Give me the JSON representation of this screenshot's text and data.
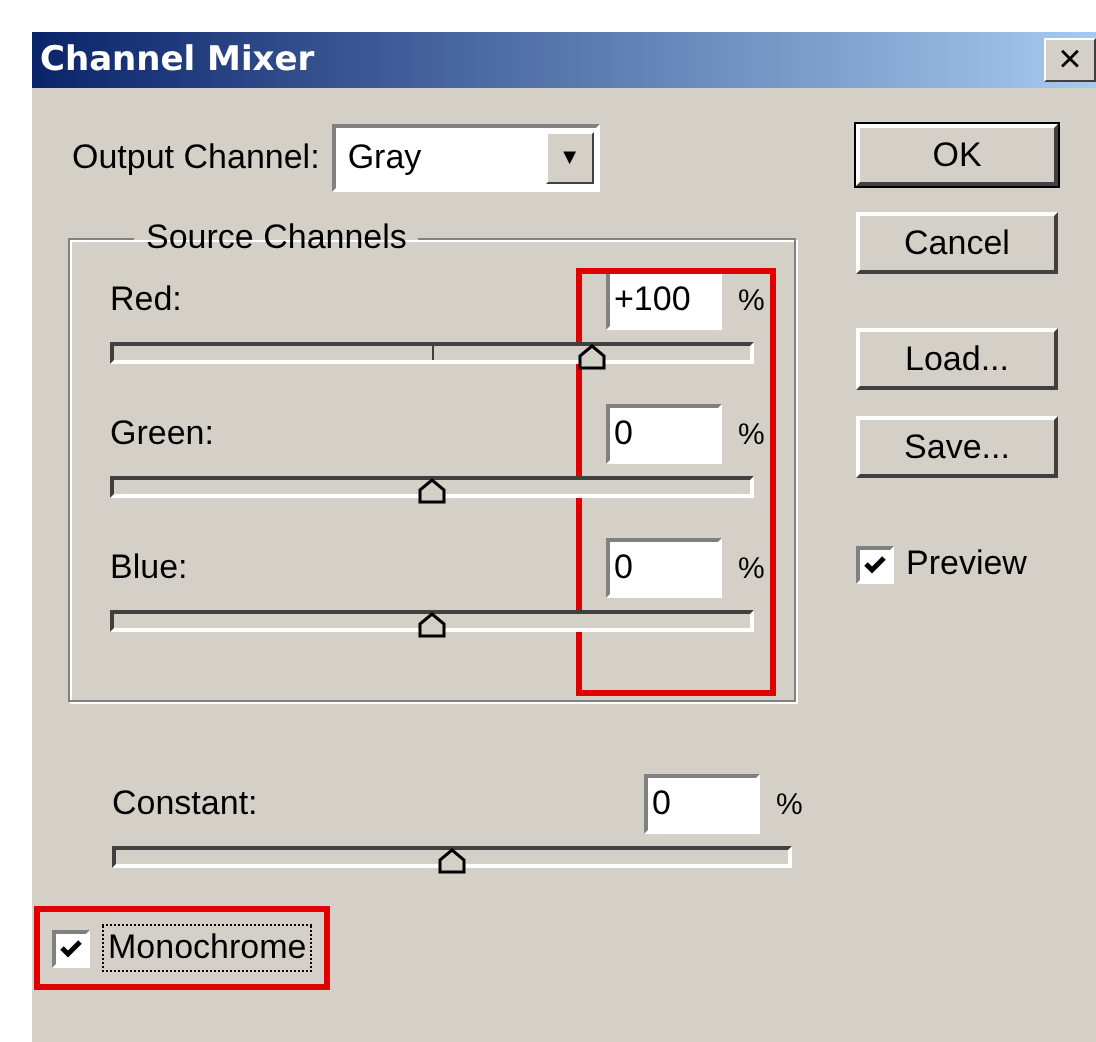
{
  "window": {
    "title": "Channel Mixer",
    "close_label": "×"
  },
  "output_channel": {
    "label": "Output Channel:",
    "value": "Gray",
    "dropdown_arrow": "▼"
  },
  "source_channels": {
    "title": "Source Channels",
    "highlighted": true,
    "channels": [
      {
        "label": "Red:",
        "value": "+100",
        "unit": "%",
        "level": 0.75
      },
      {
        "label": "Green:",
        "value": "0",
        "unit": "%",
        "level": 0.5
      },
      {
        "label": "Blue:",
        "value": "0",
        "unit": "%",
        "level": 0.5
      }
    ]
  },
  "constant": {
    "label": "Constant:",
    "value": "0",
    "unit": "%",
    "level": 0.5
  },
  "monochrome": {
    "label": "Monochrome",
    "checked": true,
    "highlighted": true,
    "focused": true
  },
  "buttons": [
    {
      "label": "OK",
      "default": true
    },
    {
      "label": "Cancel",
      "default": false
    },
    {
      "label": "Load...",
      "default": false
    },
    {
      "label": "Save...",
      "default": false
    }
  ],
  "preview": {
    "label": "Preview",
    "checked": true
  }
}
